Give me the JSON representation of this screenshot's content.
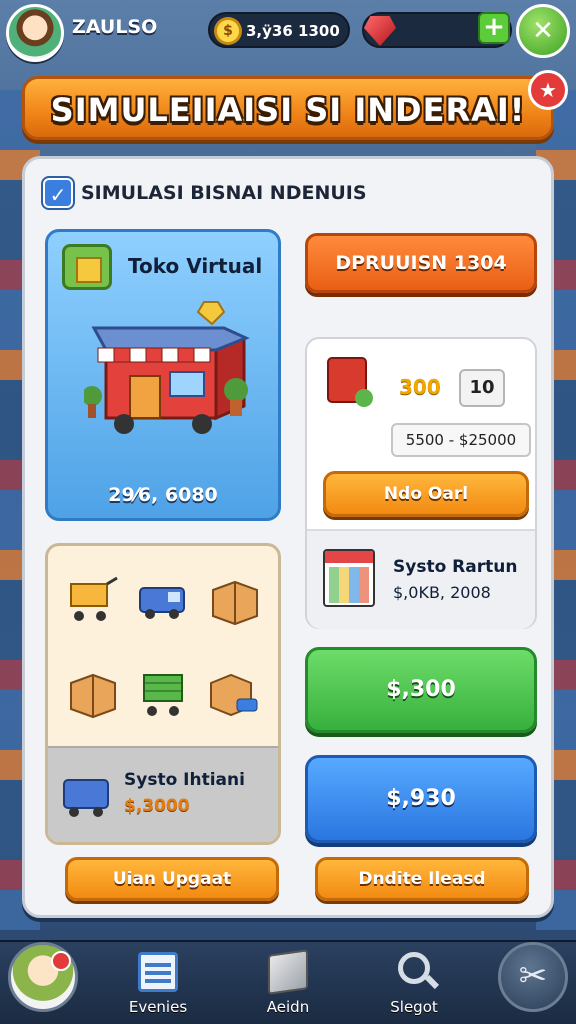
{
  "top_bar": {
    "player_name": "ZAULSO",
    "coin_symbol": "$",
    "coin_value": "3,ÿ36 1300",
    "plus_label": "+",
    "settings_glyph": "✕"
  },
  "title_banner": {
    "title": "SIMULEIIAISI SI INDERAI!",
    "close_glyph": "★"
  },
  "panel": {
    "header_text": "SIMULASI BISNAI NDENUIS",
    "check_glyph": "✓"
  },
  "shop_card": {
    "title": "Toko Virtual",
    "value": "29⁄6, 6080"
  },
  "inventory_card": {
    "title": "Systo Ihtiani",
    "price": "$,3000"
  },
  "right_column": {
    "top_button": "DPRUUISN 1304",
    "trade_price": "300",
    "quantity": "10",
    "price_range": "5500 - $25000",
    "buy_button": "Ndo Oarl",
    "report_title": "Systo Rartun",
    "report_value": "$,0KB, 2008",
    "green_button": "$,300",
    "blue_button": "$,930"
  },
  "bottom_buttons": {
    "left": "Uian Upgaat",
    "right": "Dndite Ileasd"
  },
  "bottom_nav": {
    "items": [
      {
        "label": "Evenies",
        "icon": "events-icon"
      },
      {
        "label": "Aeidn",
        "icon": "stock-icon"
      },
      {
        "label": "Slegot",
        "icon": "search-icon"
      }
    ],
    "tools_glyph": "✂"
  },
  "colors": {
    "accent_orange": "#f08418",
    "accent_green": "#38b03d",
    "accent_blue": "#2a76e0",
    "panel_bg": "#f1f3f6"
  }
}
